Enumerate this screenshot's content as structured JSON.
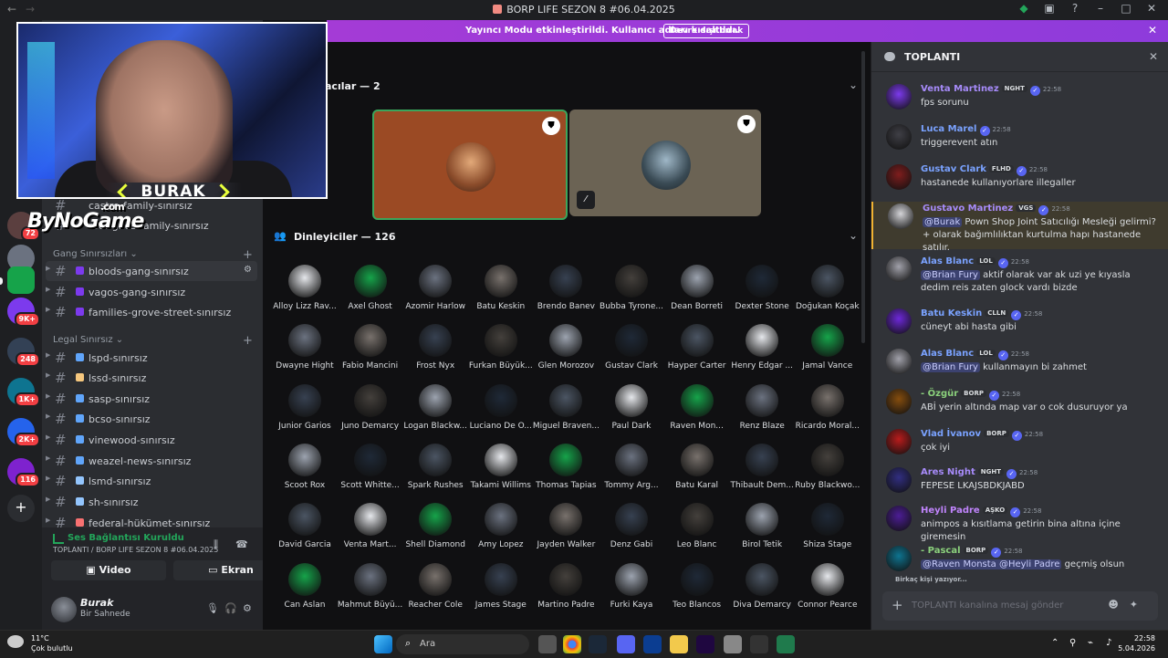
{
  "window": {
    "title": "BORP LIFE SEZON 8 #06.04.2025"
  },
  "streamer_banner": {
    "text": "Yayıncı Modu etkinleştirildi. Kullanıcı adları kısaltıldı.",
    "button": "Devre dışı bırak"
  },
  "overlay": {
    "name": "BURAK",
    "watermark": "ByNoGame",
    "watermark_sub": ".com"
  },
  "server_badges": [
    "72",
    "9K+",
    "248",
    "1K+",
    "2K+",
    "116"
  ],
  "sidebar": {
    "partial_channels": [
      "castro-family-sınırsız",
      "rodrigues-family-sınırsız"
    ],
    "categories": [
      {
        "label": "Gang Sınırsızları",
        "channels": [
          "bloods-gang-sınırsız",
          "vagos-gang-sınırsız",
          "families-grove-street-sınırsız"
        ]
      },
      {
        "label": "Legal Sınırsız",
        "channels": [
          "lspd-sınırsız",
          "lssd-sınırsız",
          "sasp-sınırsız",
          "bcso-sınırsız",
          "vinewood-sınırsız",
          "weazel-news-sınırsız",
          "lsmd-sınırsız",
          "sh-sınırsız",
          "federal-hükümet-sınırsız"
        ]
      }
    ]
  },
  "voice": {
    "status": "Ses Bağlantısı Kuruldu",
    "subtitle": "TOPLANTI / BORP LIFE SEZON 8 #06.04.2025",
    "video_label": "Video",
    "screen_label": "Ekran"
  },
  "user": {
    "name": "Burak",
    "status": "Bir Sahnede"
  },
  "stage": {
    "speakers_title": "acılar — 2",
    "listeners_title": "Dinleyiciler — 126",
    "listeners": [
      "Alloy Lizz Rav...",
      "Axel Ghost",
      "Azomir Harlow",
      "Batu Keskin",
      "Brendo Banev",
      "Bubba Tyrone...",
      "Dean Borreti",
      "Dexter Stone",
      "Doğukan Koçak",
      "Dwayne Hight",
      "Fabio Mancini",
      "Frost Nyx",
      "Furkan Büyük...",
      "Glen Morozov",
      "Gustav Clark",
      "Hayper Carter",
      "Henry Edgar ...",
      "Jamal Vance",
      "Junior Garios",
      "Juno Demarcy",
      "Logan Blackw...",
      "Luciano De O...",
      "Miguel Braven...",
      "Paul Dark",
      "Raven Mon...",
      "Renz Blaze",
      "Ricardo Moral...",
      "Scoot Rox",
      "Scott Whitte...",
      "Spark Rushes",
      "Takami Willims",
      "Thomas Tapias",
      "Tommy Arg...",
      "Batu Karal",
      "Thibault Dem...",
      "Ruby Blackwo...",
      "David Garcia",
      "Venta Mart...",
      "Shell Diamond",
      "Amy Lopez",
      "Jayden Walker",
      "Denz Gabi",
      "Leo Blanc",
      "Birol Tetik",
      "Shiza Stage",
      "Can Aslan",
      "Mahmut Büyü...",
      "Reacher Cole",
      "James Stage",
      "Martino Padre",
      "Furki Kaya",
      "Teo Blancos",
      "Diva Demarcy",
      "Connor Pearce"
    ]
  },
  "chat": {
    "title": "TOPLANTI",
    "messages": [
      {
        "author": "Venta Martinez",
        "tag": "NGHT",
        "time": "22:58",
        "text": "fps sorunu",
        "color": "#a78bfa"
      },
      {
        "author": "Luca Marel",
        "tag": "",
        "time": "22:58",
        "text": "triggerevent atın",
        "color": "#7aa2ff"
      },
      {
        "author": "Gustav Clark",
        "tag": "FLHD",
        "time": "22:58",
        "text": "hastanede kullanıyorlare illegaller",
        "color": "#7aa2ff"
      },
      {
        "author": "Gustavo Martinez",
        "tag": "VGS",
        "time": "22:58",
        "mention": "@Burak",
        "text": "Pown Shop Joint Satıcılığı Mesleği gelirmi? + olarak bağımlılıktan kurtulma hapı hastanede satılır.",
        "color": "#a78bfa"
      },
      {
        "author": "Alas Blanc",
        "tag": "LOL",
        "time": "22:58",
        "mention": "@Brian Fury",
        "text": "aktif olarak var ak uzi ye kıyasla dedim reis zaten glock vardı bizde",
        "color": "#7aa2ff"
      },
      {
        "author": "Batu Keskin",
        "tag": "CLLN",
        "time": "22:58",
        "text": "cüneyt abi hasta gibi",
        "color": "#7aa2ff"
      },
      {
        "author": "Alas Blanc",
        "tag": "LOL",
        "time": "22:58",
        "mention": "@Brian Fury",
        "text": "kullanmayın bi zahmet",
        "color": "#7aa2ff"
      },
      {
        "author": "- Özgür",
        "tag": "BORP",
        "time": "22:58",
        "text": "ABİ yerin altında map var o cok dusuruyor ya",
        "color": "#8bd17c"
      },
      {
        "author": "Vlad İvanov",
        "tag": "BORP",
        "time": "22:58",
        "text": "çok iyi",
        "color": "#7aa2ff"
      },
      {
        "author": "Ares Night",
        "tag": "NGHT",
        "time": "22:58",
        "text": "FEPESE LKAJSBDKJABD",
        "color": "#a78bfa"
      },
      {
        "author": "Heyli Padre",
        "tag": "AŞKO",
        "time": "22:58",
        "text": "animpos a kısıtlama getirin bina altına içine giremesin",
        "color": "#c084fc"
      },
      {
        "author": "- Pascal",
        "tag": "BORP",
        "time": "22:58",
        "mention": "@Raven Monsta @Heyli Padre",
        "text": "geçmiş olsun",
        "color": "#8bd17c"
      }
    ],
    "typing": "Birkaç kişi yazıyor...",
    "composer_placeholder": "TOPLANTI kanalına mesaj gönder"
  },
  "taskbar": {
    "weather_temp": "11°C",
    "weather_desc": "Çok bulutlu",
    "search": "Ara",
    "time": "22:58",
    "date": "5.04.2026"
  }
}
